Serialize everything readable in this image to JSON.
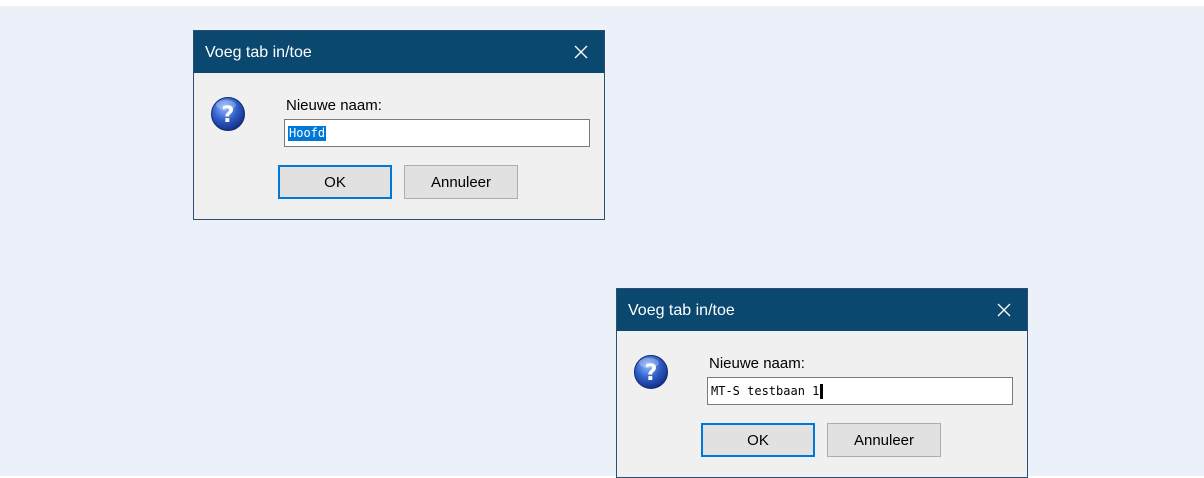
{
  "colors": {
    "titlebar": "#0b4870",
    "desktop": "#ecf0f8",
    "dialog_bg": "#f0f0f0",
    "selection": "#0078d7",
    "ok_border": "#0078d7"
  },
  "dialogs": [
    {
      "title": "Voeg tab in/toe",
      "close_icon": "close-icon",
      "message_icon": "question-icon",
      "prompt": "Nieuwe naam:",
      "input_value": "Hoofd",
      "input_text_selected": true,
      "ok_label": "OK",
      "cancel_label": "Annuleer"
    },
    {
      "title": "Voeg tab in/toe",
      "close_icon": "close-icon",
      "message_icon": "question-icon",
      "prompt": "Nieuwe naam:",
      "input_value": "MT-S testbaan 1",
      "input_text_selected": false,
      "ok_label": "OK",
      "cancel_label": "Annuleer"
    }
  ]
}
